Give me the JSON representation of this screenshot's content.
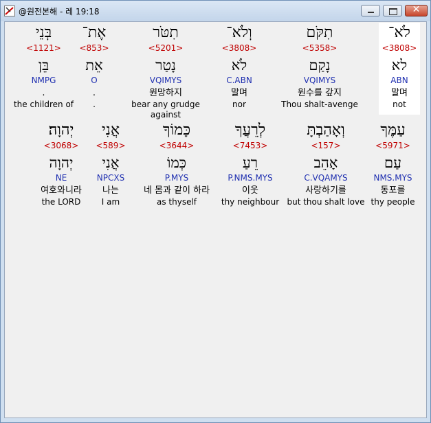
{
  "window": {
    "title": "@원전본해 - 레 19:18",
    "buttons": {
      "minimize_icon": "minimize-icon",
      "maximize_icon": "maximize-icon",
      "close_glyph": "✕"
    }
  },
  "rows": [
    [
      {
        "heb": "לֹא־",
        "strong": "<3808>",
        "root": "לא",
        "morph": "ABN",
        "kor": "말며",
        "eng": "not",
        "selected": true
      },
      {
        "heb": "תִקֹּם",
        "strong": "<5358>",
        "root": "נָקַם",
        "morph": "VQIMYS",
        "kor": "원수를 갚지",
        "eng": "Thou shalt-avenge"
      },
      {
        "heb": "וְלֹא־",
        "strong": "<3808>",
        "root": "לֹא",
        "morph": "C.ABN",
        "kor": "말며",
        "eng": "nor"
      },
      {
        "heb": "תִטֹּר",
        "strong": "<5201>",
        "root": "נָטַר",
        "morph": "VQIMYS",
        "kor": "원망하지",
        "eng": "bear any grudge against"
      },
      {
        "heb": "אֶת־",
        "strong": "<853>",
        "root": "אֵת",
        "morph": "O",
        "kor": ".",
        "eng": "."
      },
      {
        "heb": "בְּנֵי",
        "strong": "<1121>",
        "root": "בֵּן",
        "morph": "NMPG",
        "kor": ".",
        "eng": "the children of"
      }
    ],
    [
      {
        "heb": "עַמֶּךָ",
        "strong": "<5971>",
        "root": "עַם",
        "morph": "NMS.MYS",
        "kor": "동포를",
        "eng": "thy people"
      },
      {
        "heb": "וְאָהַבְתָּ",
        "strong": "<157>",
        "root": "אָהֵב",
        "morph": "C.VQAMYS",
        "kor": "사랑하기를",
        "eng": "but thou shalt love"
      },
      {
        "heb": "לְרֵעֲךָ",
        "strong": "<7453>",
        "root": "רֵעַ",
        "morph": "P.NMS.MYS",
        "kor": "이웃",
        "eng": "thy neighbour"
      },
      {
        "heb": "כָּמוֹךָ",
        "strong": "<3644>",
        "root": "כְּמוֹ",
        "morph": "P.MYS",
        "kor": "네 몸과 같이 하라",
        "eng": "as thyself"
      },
      {
        "heb": "אֲנִי",
        "strong": "<589>",
        "root": "אֲנִי",
        "morph": "NPCXS",
        "kor": "나는",
        "eng": "I am"
      },
      {
        "heb": "יְהוָה׃",
        "strong": "<3068>",
        "root": "יְהוָה",
        "morph": "NE",
        "kor": "여호와니라",
        "eng": "the LORD"
      }
    ]
  ]
}
